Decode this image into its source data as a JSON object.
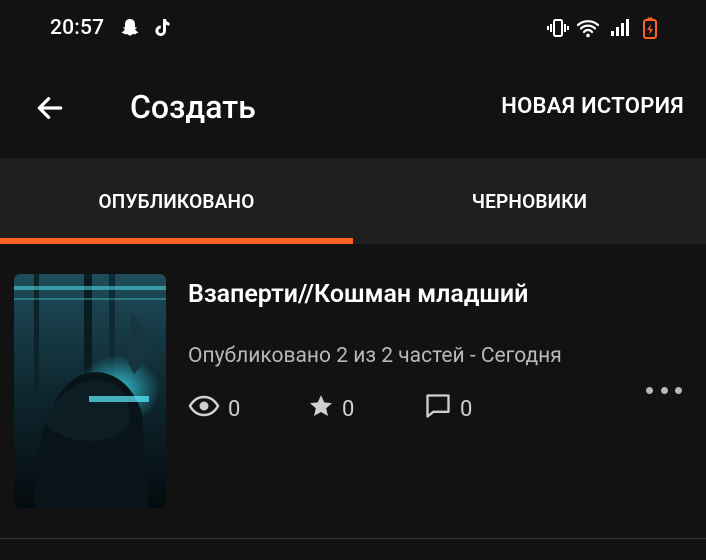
{
  "status_bar": {
    "time": "20:57",
    "left_icons": [
      "snapchat-icon",
      "tiktok-icon"
    ],
    "right_icons": [
      "vibrate-icon",
      "wifi-icon",
      "signal-icon",
      "battery-charging-icon"
    ]
  },
  "app_bar": {
    "title": "Создать",
    "action_label": "НОВАЯ ИСТОРИЯ"
  },
  "tabs": [
    {
      "label": "ОПУБЛИКОВАНО",
      "active": true
    },
    {
      "label": "ЧЕРНОВИКИ",
      "active": false
    }
  ],
  "story": {
    "title": "Взаперти//Кошман младший",
    "meta": "Опубликовано 2 из 2 частей - Сегодня",
    "views": "0",
    "votes": "0",
    "comments": "0"
  },
  "colors": {
    "accent": "#ff6122",
    "background": "#121212",
    "tab_bar": "#1f1f1f",
    "battery": "#ff6122"
  }
}
